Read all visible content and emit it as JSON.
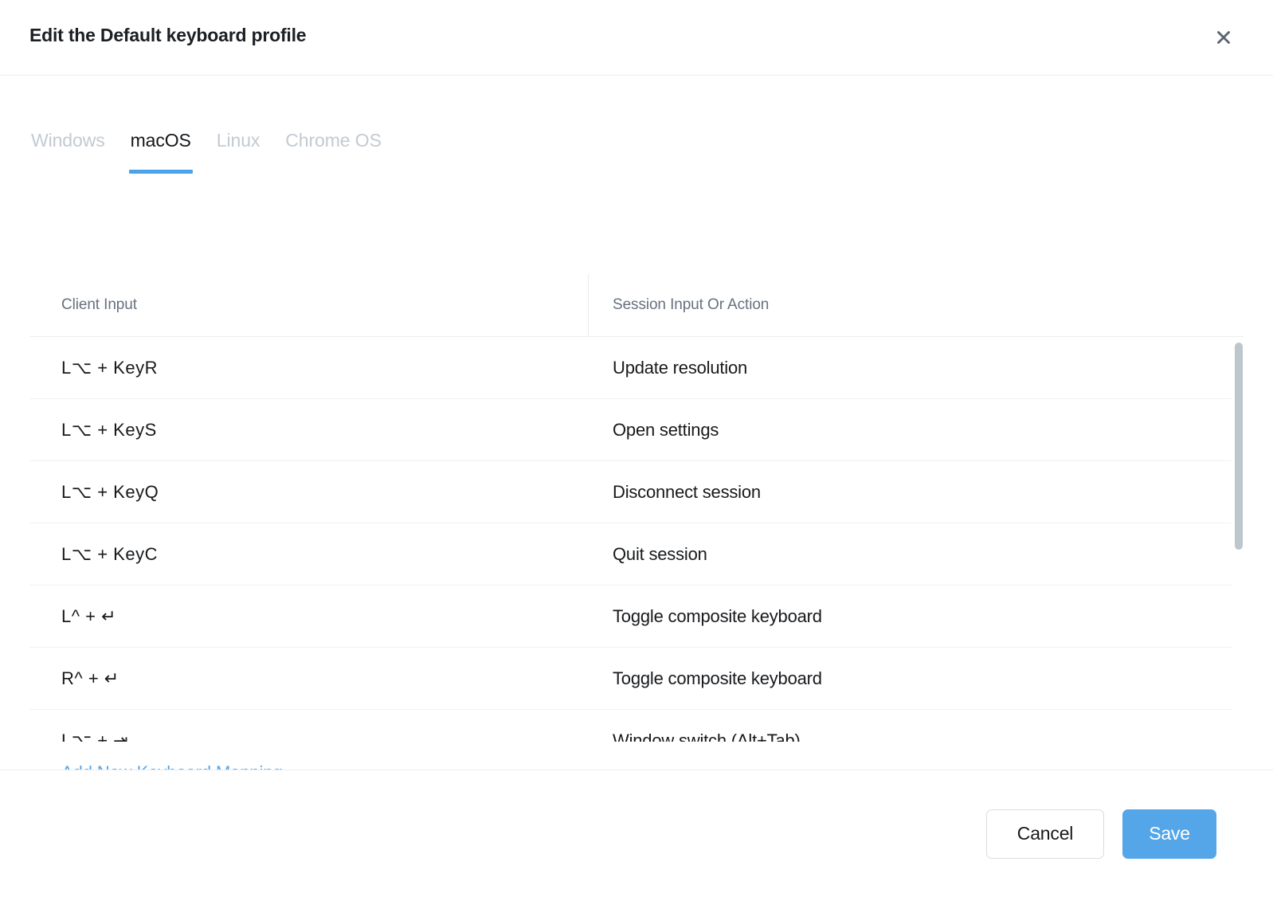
{
  "dialog": {
    "title": "Edit the Default keyboard profile",
    "close_icon": "close-icon"
  },
  "tabs": [
    {
      "label": "Windows",
      "active": false
    },
    {
      "label": "macOS",
      "active": true
    },
    {
      "label": "Linux",
      "active": false
    },
    {
      "label": "Chrome OS",
      "active": false
    }
  ],
  "table": {
    "headers": {
      "client_input": "Client Input",
      "session_input_or_action": "Session Input Or Action"
    },
    "rows": [
      {
        "client_input": "L⌥ + KeyR",
        "action": "Update resolution"
      },
      {
        "client_input": "L⌥ + KeyS",
        "action": "Open settings"
      },
      {
        "client_input": "L⌥ + KeyQ",
        "action": "Disconnect session"
      },
      {
        "client_input": "L⌥ + KeyC",
        "action": "Quit session"
      },
      {
        "client_input": "L^ + ↵",
        "action": "Toggle composite keyboard"
      },
      {
        "client_input": "R^ + ↵",
        "action": "Toggle composite keyboard"
      },
      {
        "client_input": "L⌥ + ⇥",
        "action": "Window switch (Alt+Tab)"
      }
    ]
  },
  "links": {
    "add_new_keyboard_mapping": "Add New Keyboard Mapping"
  },
  "footer": {
    "cancel_label": "Cancel",
    "save_label": "Save"
  },
  "colors": {
    "accent": "#54a6e8",
    "tab_inactive": "#c2cad2",
    "header_text": "#68717e",
    "scrollbar": "#bcc7cb"
  }
}
